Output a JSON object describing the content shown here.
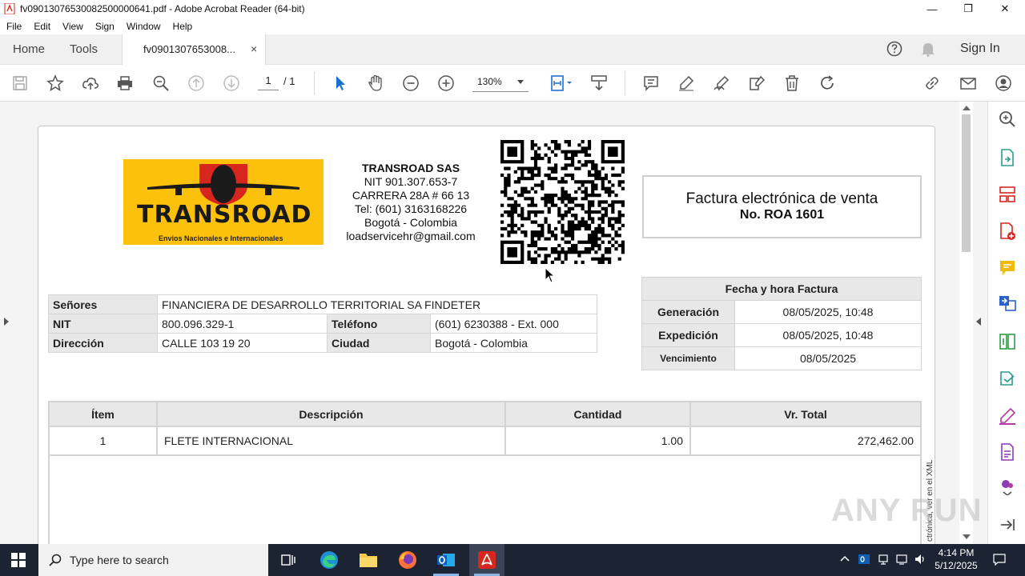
{
  "window": {
    "title": "fv09013076530082500000641.pdf - Adobe Acrobat Reader (64-bit)",
    "minimize": "—",
    "maximize": "❐",
    "close": "✕"
  },
  "menu": [
    "File",
    "Edit",
    "View",
    "Sign",
    "Window",
    "Help"
  ],
  "tabs": {
    "home": "Home",
    "tools": "Tools",
    "doc": "fv0901307653008...",
    "doc_close": "×",
    "signin": "Sign In"
  },
  "toolbar": {
    "page_current": "1",
    "page_total": "/ 1",
    "zoom": "130%"
  },
  "invoice": {
    "logo_text": "TRANSROAD",
    "logo_sub": "Envios Nacionales e Internacionales",
    "company": {
      "name": "TRANSROAD SAS",
      "nit": "NIT 901.307.653-7",
      "address": "CARRERA 28A # 66 13",
      "tel": "Tel: (601) 3163168226",
      "city": "Bogotá - Colombia",
      "email": "loadservicehr@gmail.com"
    },
    "title_line1": "Factura electrónica de venta",
    "title_line2": "No. ROA 1601",
    "client": {
      "senores_label": "Señores",
      "senores_value": "FINANCIERA DE DESARROLLO TERRITORIAL SA FINDETER",
      "nit_label": "NIT",
      "nit_value": "800.096.329-1",
      "telefono_label": "Teléfono",
      "telefono_value": "(601) 6230388 - Ext. 000",
      "direccion_label": "Dirección",
      "direccion_value": "CALLE 103 19 20",
      "ciudad_label": "Ciudad",
      "ciudad_value": "Bogotá - Colombia"
    },
    "dates": {
      "header": "Fecha y hora Factura",
      "generacion_label": "Generación",
      "generacion_value": "08/05/2025, 10:48",
      "expedicion_label": "Expedición",
      "expedicion_value": "08/05/2025, 10:48",
      "vencimiento_label": "Vencimiento",
      "vencimiento_value": "08/05/2025"
    },
    "items": {
      "headers": [
        "Ítem",
        "Descripción",
        "Cantidad",
        "Vr. Total"
      ],
      "rows": [
        {
          "item": "1",
          "descripcion": "FLETE INTERNACIONAL",
          "cantidad": "1.00",
          "total": "272,462.00"
        }
      ]
    },
    "vertical_note": "ctrónica, ver en el XML"
  },
  "watermark": "ANY RUN",
  "taskbar": {
    "search_placeholder": "Type here to search",
    "time": "4:14 PM",
    "date": "5/12/2025"
  },
  "colors": {
    "logo_bg": "#fcc10a",
    "acrobat_red": "#d7261e",
    "taskbar_bg": "#1c2433",
    "header_gray": "#e8e8e8"
  }
}
